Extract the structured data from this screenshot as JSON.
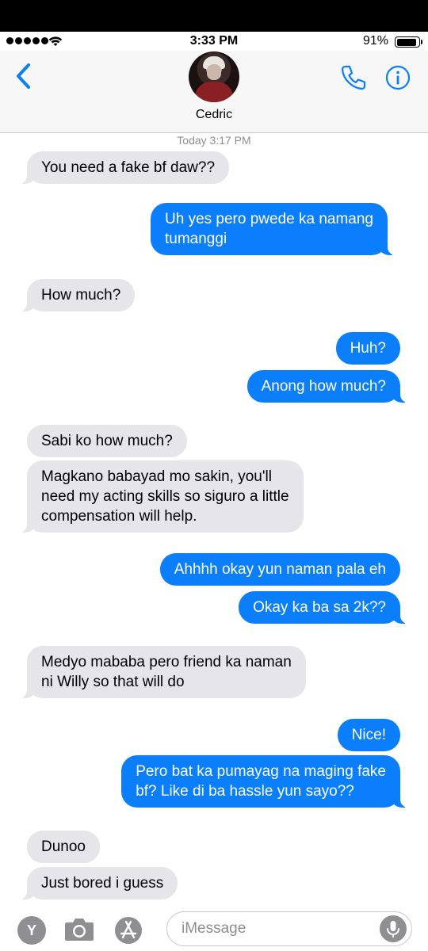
{
  "status_bar": {
    "time": "3:33 PM",
    "battery_percent": "91%",
    "signal_bars": 5,
    "battery_level": 0.91
  },
  "header": {
    "contact_name": "Cedric",
    "back_icon": "chevron-left-icon",
    "call_icon": "phone-icon",
    "info_icon": "info-icon"
  },
  "conversation": {
    "timestamp": "Today 3:17 PM",
    "messages": [
      {
        "from": "them",
        "text": "You need a fake bf daw??"
      },
      {
        "from": "me",
        "lines": [
          "Uh yes pero pwede ka namang",
          "tumanggi"
        ]
      },
      {
        "from": "them",
        "text": "How much?"
      },
      {
        "from": "me",
        "text": "Huh?"
      },
      {
        "from": "me",
        "text": "Anong how much?"
      },
      {
        "from": "them",
        "text": "Sabi ko how much?"
      },
      {
        "from": "them",
        "lines": [
          "Magkano babayad mo sakin, you'll",
          "need my acting skills so siguro a little",
          "compensation will help."
        ]
      },
      {
        "from": "me",
        "text": "Ahhhh okay yun naman pala eh"
      },
      {
        "from": "me",
        "text": "Okay ka ba sa 2k??"
      },
      {
        "from": "them",
        "lines": [
          "Medyo mababa pero friend ka naman",
          "ni Willy so that will do"
        ]
      },
      {
        "from": "me",
        "text": "Nice!"
      },
      {
        "from": "me",
        "lines": [
          "Pero bat ka pumayag na maging fake",
          "bf? Like di ba hassle yun sayo??"
        ]
      },
      {
        "from": "them",
        "text": "Dunoo"
      },
      {
        "from": "them",
        "text": "Just bored i guess"
      }
    ]
  },
  "input_bar": {
    "app_label": "Y",
    "placeholder": "iMessage",
    "icons": [
      "camera-icon",
      "app-store-icon",
      "microphone-icon"
    ]
  },
  "colors": {
    "outgoing_bubble": "#0b7ffb",
    "incoming_bubble": "#e5e5ea",
    "accent": "#0b7ffb"
  }
}
